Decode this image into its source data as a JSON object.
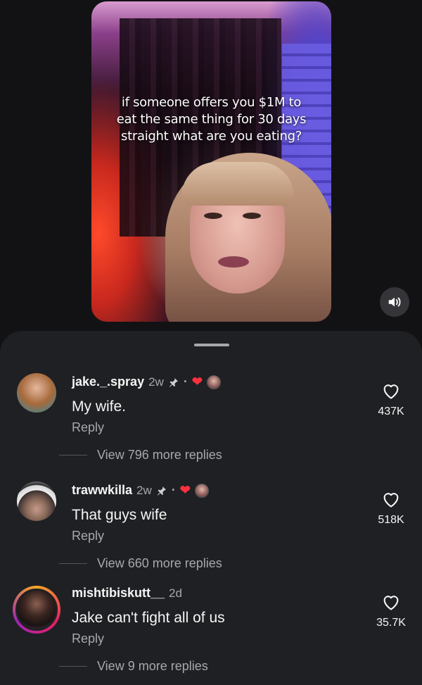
{
  "video": {
    "caption": "if someone offers you $1M to eat the same thing for 30 days straight what are you eating?",
    "sound_icon": "speaker-icon"
  },
  "comments": [
    {
      "username": "jake._.spray",
      "time": "2w",
      "pinned": true,
      "creator_liked": true,
      "text": "My wife.",
      "reply_label": "Reply",
      "likes": "437K",
      "view_replies": "View 796 more replies"
    },
    {
      "username": "trawwkilla",
      "time": "2w",
      "pinned": true,
      "creator_liked": true,
      "text": "That guys wife",
      "reply_label": "Reply",
      "likes": "518K",
      "view_replies": "View 660 more replies"
    },
    {
      "username": "mishtibiskutt__",
      "time": "2d",
      "pinned": false,
      "creator_liked": false,
      "text": "Jake can't fight all of us",
      "reply_label": "Reply",
      "likes": "35.7K",
      "view_replies": "View 9 more replies"
    }
  ],
  "colors": {
    "background": "#121214",
    "sheet": "#1f2023",
    "secondary_text": "#a8a8ac",
    "heart_red": "#ff3040"
  }
}
